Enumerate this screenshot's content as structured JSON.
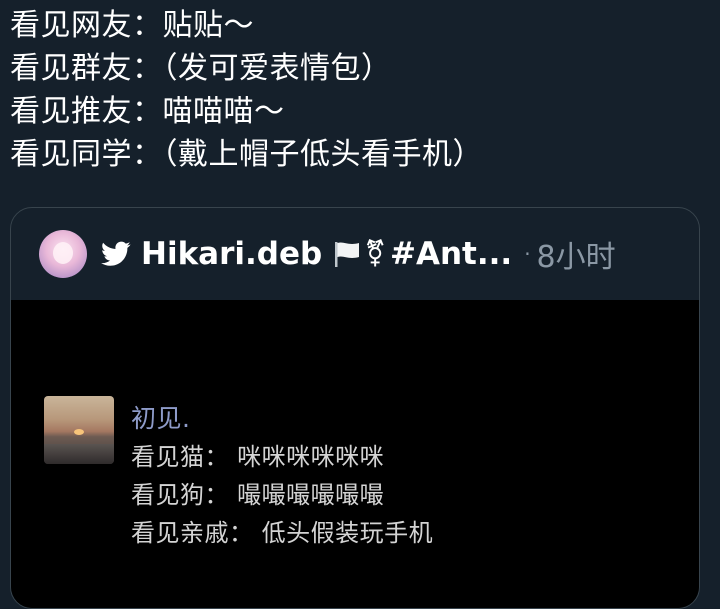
{
  "tweet": {
    "lines": [
      "看见网友：贴贴～",
      "看见群友：（发可爱表情包）",
      "看见推友：喵喵喵～",
      "看见同学：（戴上帽子低头看手机）"
    ]
  },
  "quote": {
    "author_name": "Hikari.deb",
    "gender_symbol": "⚧",
    "hashtag": "#Ant...",
    "separator": "·",
    "time": "8小时",
    "icons": [
      "avatar",
      "twitter-bird-icon",
      "white-flag-icon",
      "transgender-symbol-icon"
    ],
    "media": {
      "title": "初见.",
      "lines": [
        "看见猫：  咪咪咪咪咪咪",
        "看见狗：  嘬嘬嘬嘬嘬嘬",
        "看见亲戚：  低头假装玩手机"
      ]
    }
  },
  "colors": {
    "background": "#15202b",
    "text": "#ffffff",
    "muted": "#8b98a5",
    "border": "#38444d",
    "twitter_blue": "#ffffff",
    "media_title": "#8e9bc9"
  }
}
